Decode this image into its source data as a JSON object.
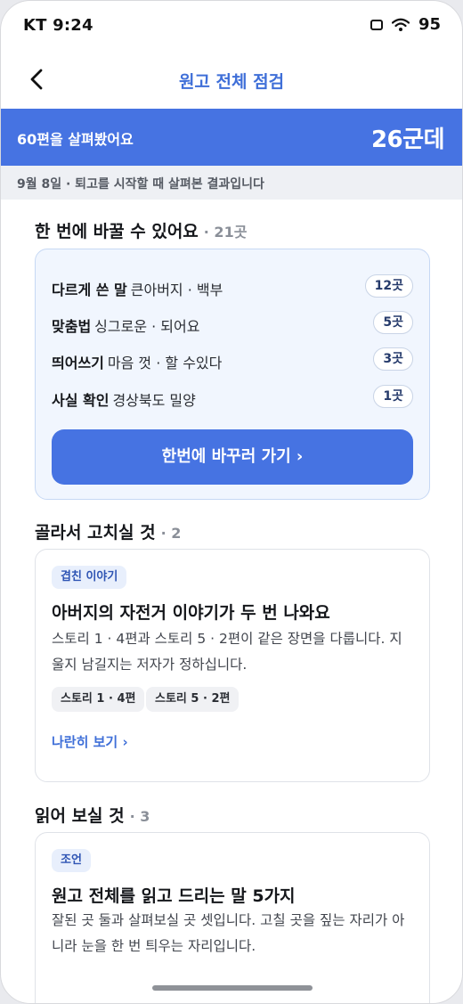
{
  "status": {
    "carrier_time": "KT 9:24",
    "battery": "95"
  },
  "header": {
    "title": "원고 전체 점검"
  },
  "summary": {
    "reviewed": "60편을 살펴봤어요",
    "count": "26군데",
    "note": "9월 8일 · 퇴고를 시작할 때 살펴본 결과입니다"
  },
  "quick_fix": {
    "title": "한 번에 바꿀 수 있어요",
    "count": "· 21곳",
    "rows": [
      {
        "label": "다르게 쓴 말",
        "text": "큰아버지 · 백부",
        "count": "12곳"
      },
      {
        "label": "맞춤법",
        "text": "싱그로운 · 되어요",
        "count": "5곳"
      },
      {
        "label": "띄어쓰기",
        "text": "마음 껏 · 할 수있다",
        "count": "3곳"
      },
      {
        "label": "사실 확인",
        "text": "경상북도 밀양",
        "count": "1곳"
      }
    ],
    "button": "한번에 바꾸러 가기 ›"
  },
  "choose_fix": {
    "title": "골라서 고치실 것",
    "count": "· 2",
    "badge": "겹친 이야기",
    "card_title": "아버지의 자전거 이야기가 두 번 나와요",
    "desc": "스토리 1 · 4편과 스토리 5 · 2편이 같은 장면을 다룹니다. 지울지 남길지는 저자가 정하십니다.",
    "chips": [
      "스토리 1 · 4편",
      "스토리 5 · 2편"
    ],
    "link": "나란히 보기 ›"
  },
  "read": {
    "title": "읽어 보실 것",
    "count": "· 3",
    "badge": "조언",
    "card_title": "원고 전체를 읽고 드리는 말 5가지",
    "desc": "잘된 곳 둘과 살펴보실 곳 셋입니다. 고칠 곳을 짚는 자리가 아니라 눈을 한 번 틔우는 자리입니다."
  }
}
